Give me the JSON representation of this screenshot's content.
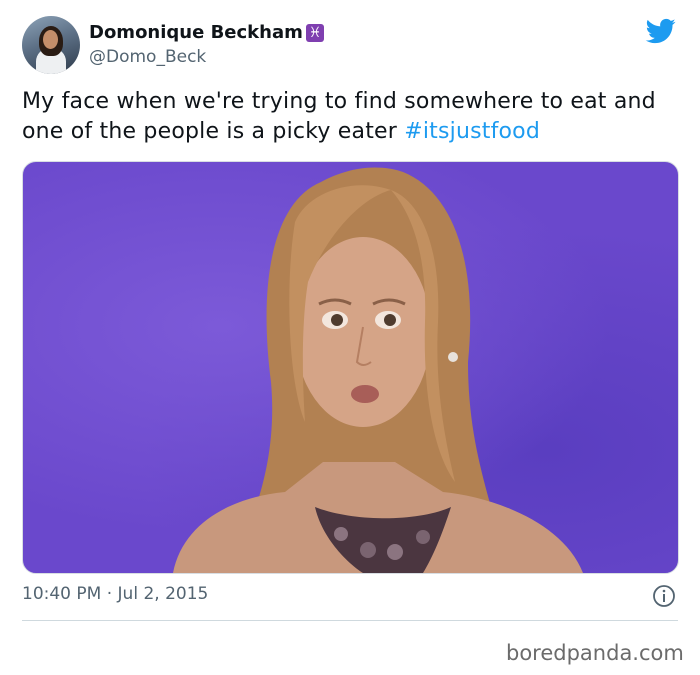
{
  "author": {
    "name": "Domonique Beckham",
    "zodiac_symbol": "♓",
    "handle": "@Domo_Beck"
  },
  "tweet": {
    "text": "My face when we're trying to find somewhere to eat and one of the people is a picky eater ",
    "hashtag": "#itsjustfood",
    "timestamp": "10:40 PM · Jul 2, 2015"
  },
  "icons": {
    "platform": "twitter-bird-icon",
    "info": "info-icon"
  },
  "watermark": "boredpanda.com",
  "colors": {
    "link": "#1d9bf0",
    "muted": "#536471",
    "zodiac_badge": "#7f3fb0",
    "media_background": "#6a48cc"
  }
}
